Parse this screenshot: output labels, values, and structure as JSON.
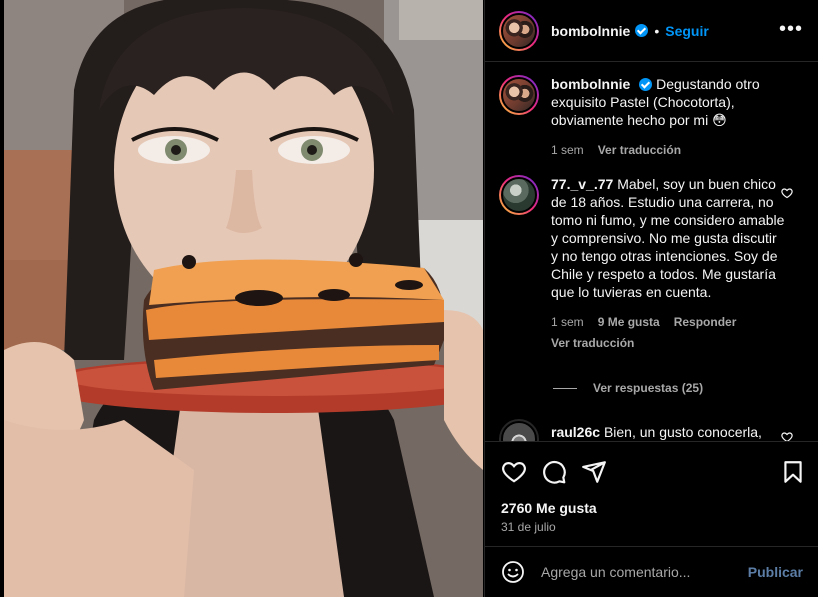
{
  "post": {
    "username": "bombolnnie",
    "follow_label": "Seguir",
    "separator": "•",
    "more_label": "•••"
  },
  "caption": {
    "username": "bombolnnie",
    "text": "Degustando otro exquisito Pastel (Chocotorta), obviamente hecho por mi 😳",
    "time": "1 sem",
    "translate_label": "Ver traducción"
  },
  "comments": [
    {
      "username": "77._v_.77",
      "text": "Mabel, soy un buen chico de 18 años. Estudio una carrera, no tomo ni fumo, y me considero amable y comprensivo. No me gusta discutir y no tengo otras intenciones. Soy de Chile y respeto a todos. Me gustaría que lo tuvieras en cuenta.",
      "time": "1 sem",
      "likes": "9 Me gusta",
      "reply_label": "Responder",
      "translate_label": "Ver traducción",
      "view_replies": "Ver respuestas (25)"
    },
    {
      "username": "raul26c",
      "text": "Bien, un gusto conocerla,"
    }
  ],
  "stats": {
    "likes": "2760 Me gusta",
    "date": "31 de julio"
  },
  "composer": {
    "placeholder": "Agrega un comentario...",
    "post_label": "Publicar"
  },
  "colors": {
    "link_blue": "#0095f6",
    "secondary_text": "#a8a8a8",
    "publish_disabled": "#5c7ea6",
    "divider": "#262626"
  }
}
